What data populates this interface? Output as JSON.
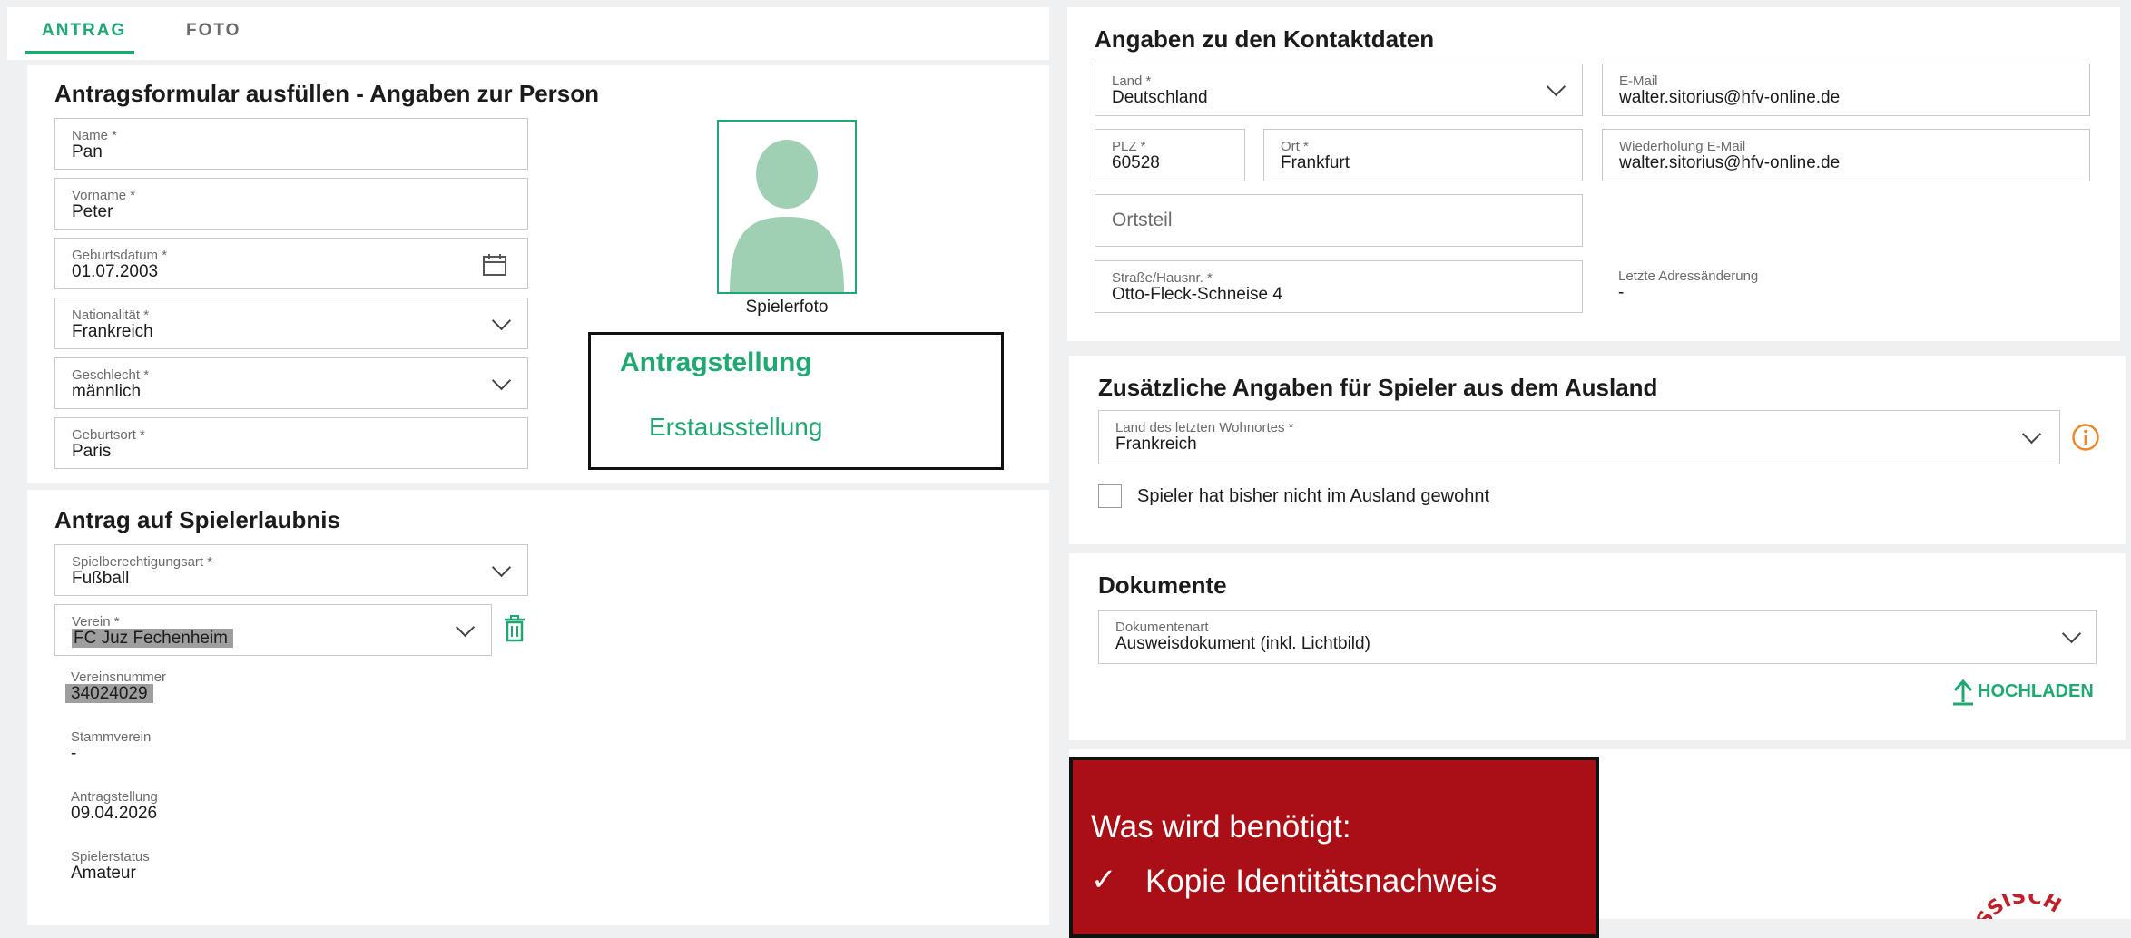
{
  "tabs": [
    {
      "label": "ANTRAG",
      "active": true
    },
    {
      "label": "FOTO",
      "active": false
    }
  ],
  "colors": {
    "accent": "#21a872",
    "alert_red": "#a90f14",
    "info_orange": "#e8892b",
    "avatar": "#9fd0b4"
  },
  "person": {
    "title": "Antragsformular ausfüllen - Angaben zur Person",
    "name": {
      "label": "Name *",
      "value": "Pan"
    },
    "vorname": {
      "label": "Vorname *",
      "value": "Peter"
    },
    "geburtsdatum": {
      "label": "Geburtsdatum *",
      "value": "01.07.2003"
    },
    "nationalitaet": {
      "label": "Nationalität *",
      "value": "Frankreich"
    },
    "geschlecht": {
      "label": "Geschlecht *",
      "value": "männlich"
    },
    "geburtsort": {
      "label": "Geburtsort *",
      "value": "Paris"
    },
    "photo_caption": "Spielerfoto",
    "antragstellung_box": {
      "title": "Antragstellung",
      "value": "Erstausstellung"
    }
  },
  "spielerlaubnis": {
    "title": "Antrag auf Spielerlaubnis",
    "spielberechtigungsart": {
      "label": "Spielberechtigungsart *",
      "value": "Fußball"
    },
    "verein": {
      "label": "Verein *",
      "value": "FC Juz Fechenheim"
    },
    "vereinsnummer": {
      "label": "Vereinsnummer",
      "value": "34024029"
    },
    "stammverein": {
      "label": "Stammverein",
      "value": "-"
    },
    "antragstellung": {
      "label": "Antragstellung",
      "value": "09.04.2026"
    },
    "spielerstatus": {
      "label": "Spielerstatus",
      "value": "Amateur"
    }
  },
  "kontakt": {
    "title": "Angaben zu den Kontaktdaten",
    "land": {
      "label": "Land *",
      "value": "Deutschland"
    },
    "email": {
      "label": "E-Mail",
      "value": "walter.sitorius@hfv-online.de"
    },
    "plz": {
      "label": "PLZ *",
      "value": "60528"
    },
    "ort": {
      "label": "Ort *",
      "value": "Frankfurt"
    },
    "email_repeat": {
      "label": "Wiederholung E-Mail",
      "value": "walter.sitorius@hfv-online.de"
    },
    "ortsteil": {
      "placeholder": "Ortsteil"
    },
    "strasse": {
      "label": "Straße/Hausnr. *",
      "value": "Otto-Fleck-Schneise 4"
    },
    "adressaenderung": {
      "label": "Letzte Adressänderung",
      "value": "-"
    }
  },
  "ausland": {
    "title": "Zusätzliche Angaben für Spieler aus dem Ausland",
    "land_wohnort": {
      "label": "Land des letzten Wohnortes *",
      "value": "Frankreich"
    },
    "checkbox_label": "Spieler hat bisher nicht im Ausland gewohnt",
    "checkbox_checked": false
  },
  "dokumente": {
    "title": "Dokumente",
    "dokumentenart": {
      "label": "Dokumentenart",
      "value": "Ausweisdokument (inkl. Lichtbild)"
    },
    "upload_label": "HOCHLADEN"
  },
  "callout": {
    "title": "Was wird benötigt:",
    "items": [
      "Kopie Identitätsnachweis"
    ],
    "check_symbol": "✓"
  },
  "seal_text": "ESSISCH"
}
